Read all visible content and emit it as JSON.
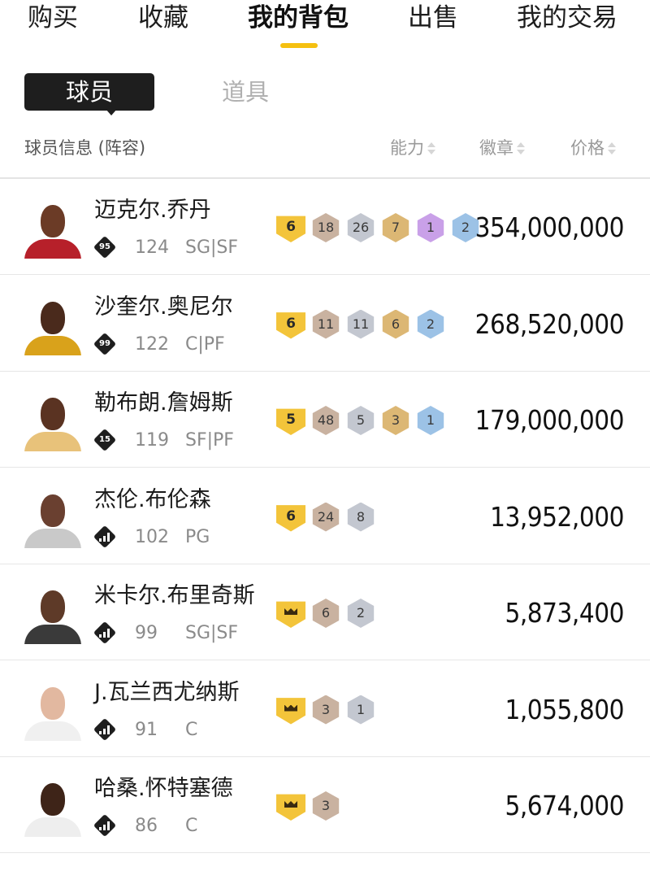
{
  "nav": {
    "tabs": [
      "购买",
      "收藏",
      "我的背包",
      "出售",
      "我的交易"
    ],
    "active_index": 2
  },
  "subtabs": {
    "active": "球员",
    "inactive": "道具"
  },
  "columns": {
    "info": "球员信息 (阵容)",
    "ability": "能力",
    "badge": "徽章",
    "price": "价格"
  },
  "colors": {
    "accent": "#f5c010",
    "level_badge": "#f3c43a",
    "bronze": "#c9b2a0",
    "silver": "#c3c7d0",
    "gold": "#dcb774",
    "purple": "#c9a0e8",
    "blue": "#9cc2e6"
  },
  "players": [
    {
      "name": "迈克尔.乔丹",
      "mark": "95",
      "mark_type": "number",
      "ovr": "124",
      "pos": "SG|SF",
      "level": "6",
      "badges": [
        {
          "t": "bronze",
          "n": "18"
        },
        {
          "t": "silver",
          "n": "26"
        },
        {
          "t": "gold",
          "n": "7"
        },
        {
          "t": "purple",
          "n": "1"
        },
        {
          "t": "blue",
          "n": "2"
        }
      ],
      "price": "354,000,000"
    },
    {
      "name": "沙奎尔.奥尼尔",
      "mark": "99",
      "mark_type": "number",
      "ovr": "122",
      "pos": "C|PF",
      "level": "6",
      "badges": [
        {
          "t": "bronze",
          "n": "11"
        },
        {
          "t": "silver",
          "n": "11"
        },
        {
          "t": "gold",
          "n": "6"
        },
        {
          "t": "blue",
          "n": "2"
        }
      ],
      "price": "268,520,000"
    },
    {
      "name": "勒布朗.詹姆斯",
      "mark": "15",
      "mark_type": "number",
      "ovr": "119",
      "pos": "SF|PF",
      "level": "5",
      "badges": [
        {
          "t": "bronze",
          "n": "48"
        },
        {
          "t": "silver",
          "n": "5"
        },
        {
          "t": "gold",
          "n": "3"
        },
        {
          "t": "blue",
          "n": "1"
        }
      ],
      "price": "179,000,000"
    },
    {
      "name": "杰伦.布伦森",
      "mark": "",
      "mark_type": "bars",
      "ovr": "102",
      "pos": "PG",
      "level": "6",
      "badges": [
        {
          "t": "bronze",
          "n": "24"
        },
        {
          "t": "silver",
          "n": "8"
        }
      ],
      "price": "13,952,000"
    },
    {
      "name": "米卡尔.布里奇斯",
      "mark": "",
      "mark_type": "bars",
      "ovr": "99",
      "pos": "SG|SF",
      "level": "crown",
      "badges": [
        {
          "t": "bronze",
          "n": "6"
        },
        {
          "t": "silver",
          "n": "2"
        }
      ],
      "price": "5,873,400"
    },
    {
      "name": "J.瓦兰西尤纳斯",
      "mark": "",
      "mark_type": "bars",
      "ovr": "91",
      "pos": "C",
      "level": "crown",
      "badges": [
        {
          "t": "bronze",
          "n": "3"
        },
        {
          "t": "silver",
          "n": "1"
        }
      ],
      "price": "1,055,800"
    },
    {
      "name": "哈桑.怀特塞德",
      "mark": "",
      "mark_type": "bars",
      "ovr": "86",
      "pos": "C",
      "level": "crown",
      "badges": [
        {
          "t": "bronze",
          "n": "3"
        }
      ],
      "price": "5,674,000"
    }
  ]
}
